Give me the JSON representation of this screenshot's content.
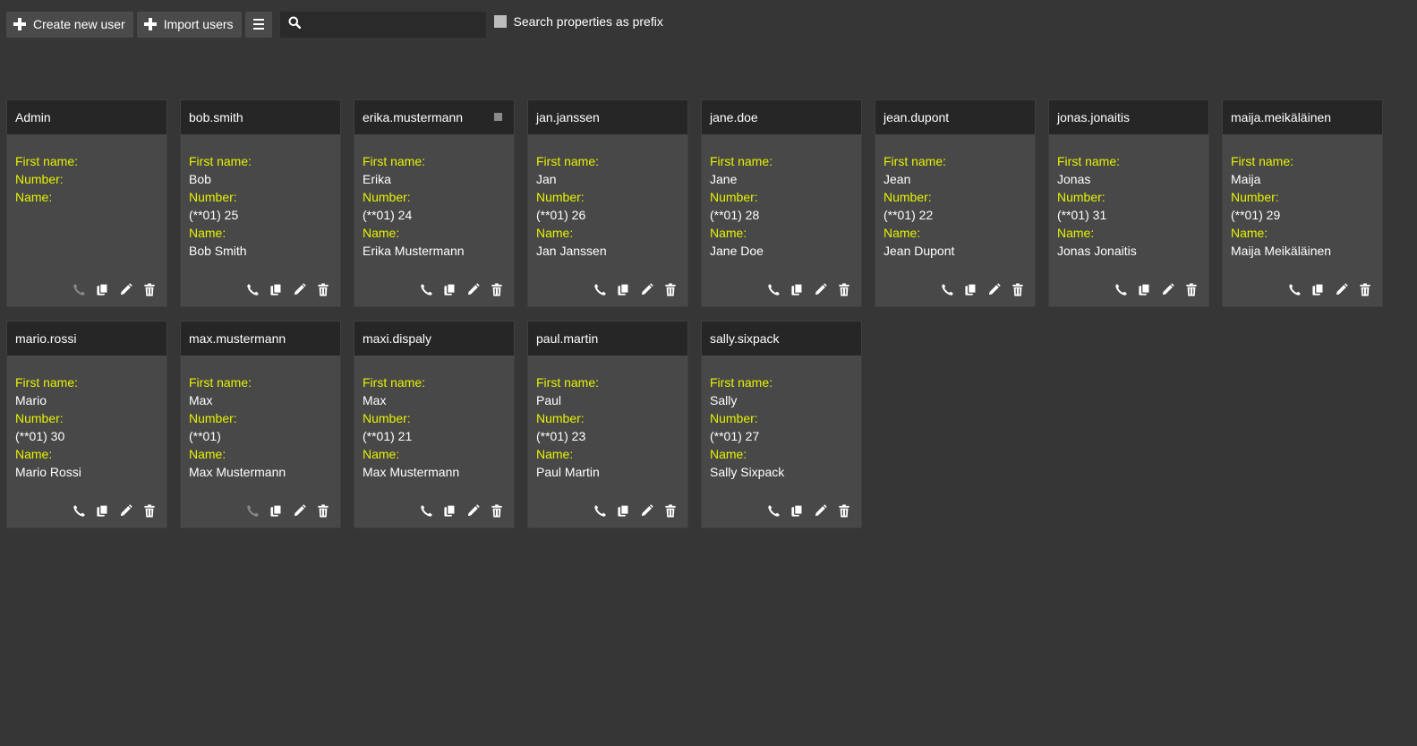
{
  "toolbar": {
    "create_label": "Create new user",
    "import_label": "Import users",
    "search_placeholder": "",
    "search_value": "",
    "prefix_label": "Search properties as prefix",
    "prefix_checked": false
  },
  "labels": {
    "first_name": "First name:",
    "number": "Number:",
    "name": "Name:"
  },
  "colors": {
    "label": "#e6f200",
    "card_bg": "#484848",
    "card_header": "#262626",
    "page_bg": "#363636"
  },
  "users": [
    {
      "username": "Admin",
      "first_name": "",
      "number": "",
      "name": "",
      "call_enabled": false,
      "marked": false
    },
    {
      "username": "bob.smith",
      "first_name": "Bob",
      "number": "(**01) 25",
      "name": "Bob Smith",
      "call_enabled": true,
      "marked": false
    },
    {
      "username": "erika.mustermann",
      "first_name": "Erika",
      "number": "(**01) 24",
      "name": "Erika Mustermann",
      "call_enabled": true,
      "marked": true
    },
    {
      "username": "jan.janssen",
      "first_name": "Jan",
      "number": "(**01) 26",
      "name": "Jan Janssen",
      "call_enabled": true,
      "marked": false
    },
    {
      "username": "jane.doe",
      "first_name": "Jane",
      "number": "(**01) 28",
      "name": "Jane Doe",
      "call_enabled": true,
      "marked": false
    },
    {
      "username": "jean.dupont",
      "first_name": "Jean",
      "number": "(**01) 22",
      "name": "Jean Dupont",
      "call_enabled": true,
      "marked": false
    },
    {
      "username": "jonas.jonaitis",
      "first_name": "Jonas",
      "number": "(**01) 31",
      "name": "Jonas Jonaitis",
      "call_enabled": true,
      "marked": false
    },
    {
      "username": "maija.meikäläinen",
      "first_name": "Maija",
      "number": "(**01) 29",
      "name": "Maija Meikäläinen",
      "call_enabled": true,
      "marked": false
    },
    {
      "username": "mario.rossi",
      "first_name": "Mario",
      "number": "(**01) 30",
      "name": "Mario Rossi",
      "call_enabled": true,
      "marked": false
    },
    {
      "username": "max.mustermann",
      "first_name": "Max",
      "number": "(**01)",
      "name": "Max Mustermann",
      "call_enabled": false,
      "marked": false
    },
    {
      "username": "maxi.dispaly",
      "first_name": "Max",
      "number": "(**01) 21",
      "name": "Max Mustermann",
      "call_enabled": true,
      "marked": false
    },
    {
      "username": "paul.martin",
      "first_name": "Paul",
      "number": "(**01) 23",
      "name": "Paul Martin",
      "call_enabled": true,
      "marked": false
    },
    {
      "username": "sally.sixpack",
      "first_name": "Sally",
      "number": "(**01) 27",
      "name": "Sally Sixpack",
      "call_enabled": true,
      "marked": false
    }
  ]
}
